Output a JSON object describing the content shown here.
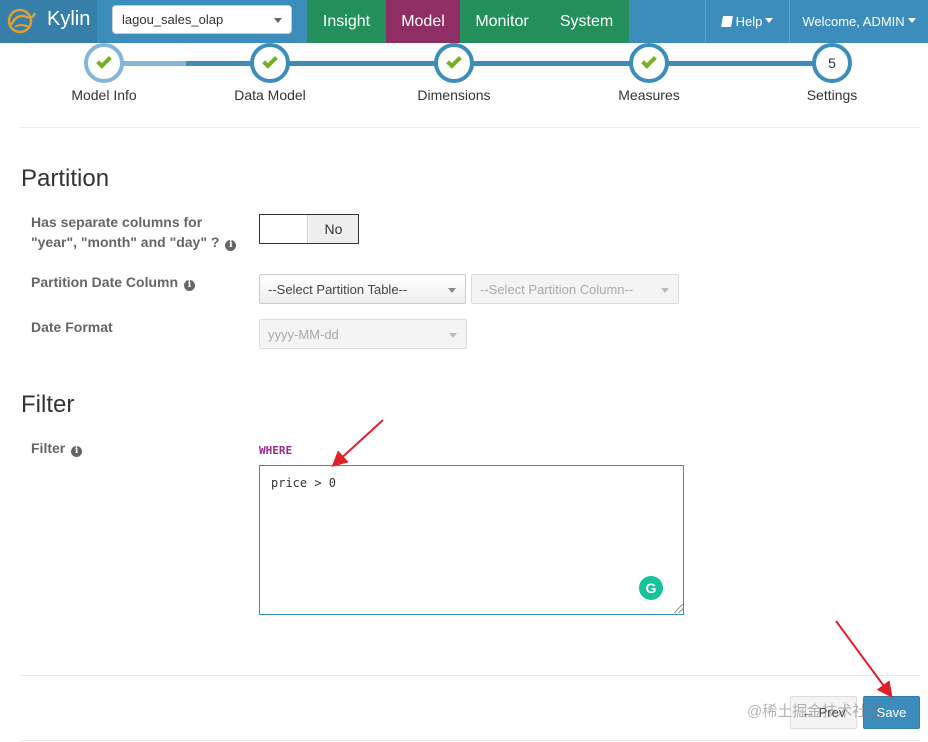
{
  "navbar": {
    "brand": "Kylin",
    "project": "lagou_sales_olap",
    "tabs": [
      {
        "label": "Insight"
      },
      {
        "label": "Model"
      },
      {
        "label": "Monitor"
      },
      {
        "label": "System"
      }
    ],
    "help_label": "Help",
    "user_label": "Welcome, ADMIN",
    "colors": {
      "bar": "#3c8dbc",
      "tabs": "#238f5b",
      "active_tab": "#8e2e64"
    }
  },
  "wizard": {
    "steps": [
      {
        "label": "Model Info",
        "state": "done"
      },
      {
        "label": "Data Model",
        "state": "done"
      },
      {
        "label": "Dimensions",
        "state": "done"
      },
      {
        "label": "Measures",
        "state": "done"
      },
      {
        "label": "Settings",
        "state": "current",
        "number": "5"
      }
    ]
  },
  "partition": {
    "title": "Partition",
    "separate_columns_label_line1": "Has separate columns for",
    "separate_columns_label_line2": "\"year\", \"month\" and \"day\" ?",
    "toggle_value": "No",
    "date_column_label": "Partition Date Column",
    "table_placeholder": "--Select Partition Table--",
    "column_placeholder": "--Select Partition Column--",
    "date_format_label": "Date Format",
    "date_format_value": "yyyy-MM-dd"
  },
  "filter": {
    "title": "Filter",
    "label": "Filter",
    "keyword": "WHERE",
    "value": "price > 0"
  },
  "footer": {
    "prev_label": "Prev",
    "save_label": "Save",
    "watermark": "@稀土掘金技术社区"
  },
  "icons": {
    "info": "info-circle-icon",
    "check": "check-icon",
    "book": "book-icon",
    "grammarly": "grammarly-icon",
    "arrow_left": "arrow-left-icon"
  }
}
